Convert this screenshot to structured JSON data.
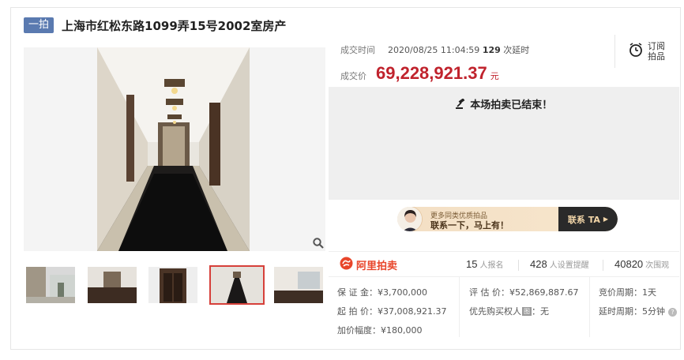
{
  "header": {
    "badge": "一拍",
    "title": "上海市红松东路1099弄15号2002室房产"
  },
  "deal": {
    "time_label": "成交时间",
    "time_value": "2020/08/25 11:04:59",
    "extend_count": "129",
    "extend_label": "次延时",
    "price_label": "成交价",
    "price": "69,228,921.37",
    "price_unit": "元"
  },
  "subscribe": {
    "label_line1": "订阅",
    "label_line2": "拍品",
    "icon": "alarm-clock-icon"
  },
  "status": {
    "ended_text": "本场拍卖已结束！",
    "icon": "gavel-icon"
  },
  "contact": {
    "small_text": "更多同类优质拍品",
    "big_text": "联系一下，马上有！",
    "button_label": "联系 TA"
  },
  "stats": {
    "brand": "阿里拍卖",
    "signups": "15",
    "signups_label": "人报名",
    "reminders": "428",
    "reminders_label": "人设置提醒",
    "views": "40820",
    "views_label": "次围观"
  },
  "details": {
    "deposit": "保 证 金：¥3,700,000",
    "start_price": "起 拍 价：¥37,008,921.37",
    "increment": "加价幅度：¥180,000",
    "appraisal": "评 估 价：¥52,869,887.67",
    "priority_prefix": "优先购买权人",
    "priority_tag": "图",
    "priority_value": "：无",
    "bid_period": "竞价周期：1天",
    "extend_period": "延时周期：5分钟"
  },
  "colors": {
    "price": "#c0232d",
    "badge": "#5a7ab0",
    "brand": "#e8452a",
    "active_thumb": "#d6403a"
  }
}
